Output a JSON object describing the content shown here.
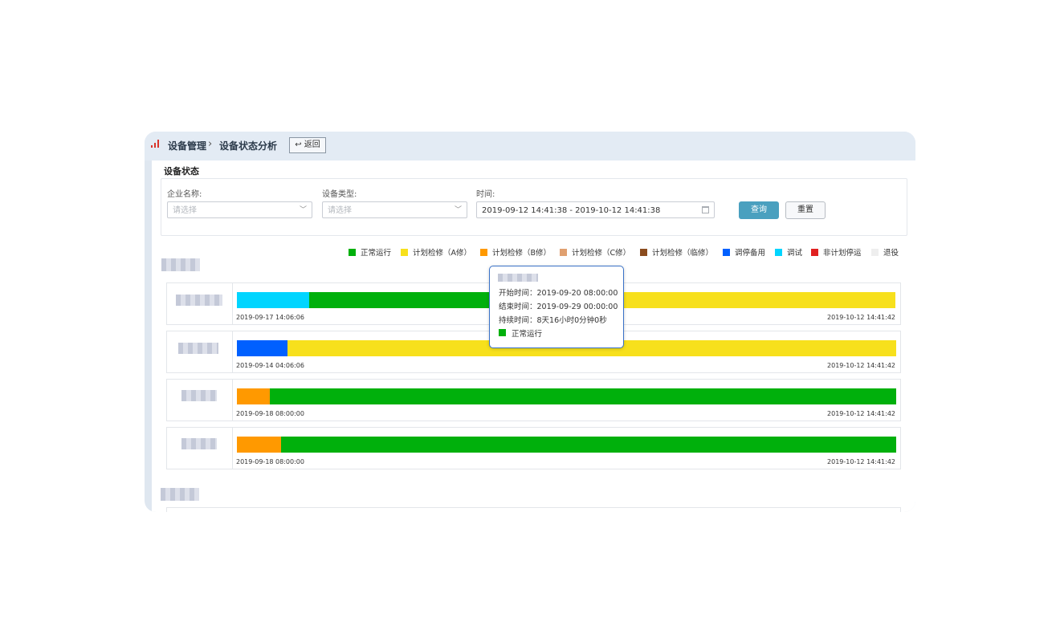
{
  "breadcrumb": {
    "level1": "设备管理",
    "separator": "›",
    "level2": "设备状态分析",
    "back_label": "↩ 返回"
  },
  "section_title": "设备状态",
  "filters": {
    "company": {
      "label": "企业名称:",
      "placeholder": "请选择"
    },
    "device_type": {
      "label": "设备类型:",
      "placeholder": "请选择"
    },
    "time": {
      "label": "时间:",
      "value": "2019-09-12 14:41:38 - 2019-10-12 14:41:38"
    },
    "query_label": "查询",
    "reset_label": "重置"
  },
  "legend": [
    {
      "label": "正常运行",
      "color": "#00b00c"
    },
    {
      "label": "计划检修（A修）",
      "color": "#f7e01c"
    },
    {
      "label": "计划检修（B修）",
      "color": "#ff9900"
    },
    {
      "label": "计划检修（C修）",
      "color": "#e0a070"
    },
    {
      "label": "计划检修（临修）",
      "color": "#8b4c1e"
    },
    {
      "label": "调停备用",
      "color": "#0060ff"
    },
    {
      "label": "调试",
      "color": "#00d5ff"
    },
    {
      "label": "非计划停运",
      "color": "#e02020"
    },
    {
      "label": "退役",
      "color": "#eeeeee"
    }
  ],
  "devices": [
    {
      "start": "2019-09-17 14:06:06",
      "end": "2019-10-12 14:41:42",
      "segments": [
        {
          "status": "调试",
          "color": "#00d5ff",
          "fraction": 0.11
        },
        {
          "status": "正常运行",
          "color": "#00b00c",
          "fraction": 0.445
        },
        {
          "status": "计划检修（A修）",
          "color": "#f7e01c",
          "fraction": 0.445
        }
      ]
    },
    {
      "start": "2019-09-14 04:06:06",
      "end": "2019-10-12 14:41:42",
      "segments": [
        {
          "status": "调停备用",
          "color": "#0060ff",
          "fraction": 0.077
        },
        {
          "status": "计划检修（A修）",
          "color": "#f7e01c",
          "fraction": 0.923
        }
      ]
    },
    {
      "start": "2019-09-18 08:00:00",
      "end": "2019-10-12 14:41:42",
      "segments": [
        {
          "status": "计划检修（B修）",
          "color": "#ff9900",
          "fraction": 0.05
        },
        {
          "status": "正常运行",
          "color": "#00b00c",
          "fraction": 0.95
        }
      ]
    },
    {
      "start": "2019-09-18 08:00:00",
      "end": "2019-10-12 14:41:42",
      "segments": [
        {
          "status": "计划检修（B修）",
          "color": "#ff9900",
          "fraction": 0.067
        },
        {
          "status": "正常运行",
          "color": "#00b00c",
          "fraction": 0.933
        }
      ]
    }
  ],
  "tooltip": {
    "start": "开始时间：2019-09-20 08:00:00",
    "end": "结束时间：2019-09-29 00:00:00",
    "duration": "持续时间：8天16小时0分钟0秒",
    "status": "正常运行",
    "status_color": "#00b00c"
  }
}
